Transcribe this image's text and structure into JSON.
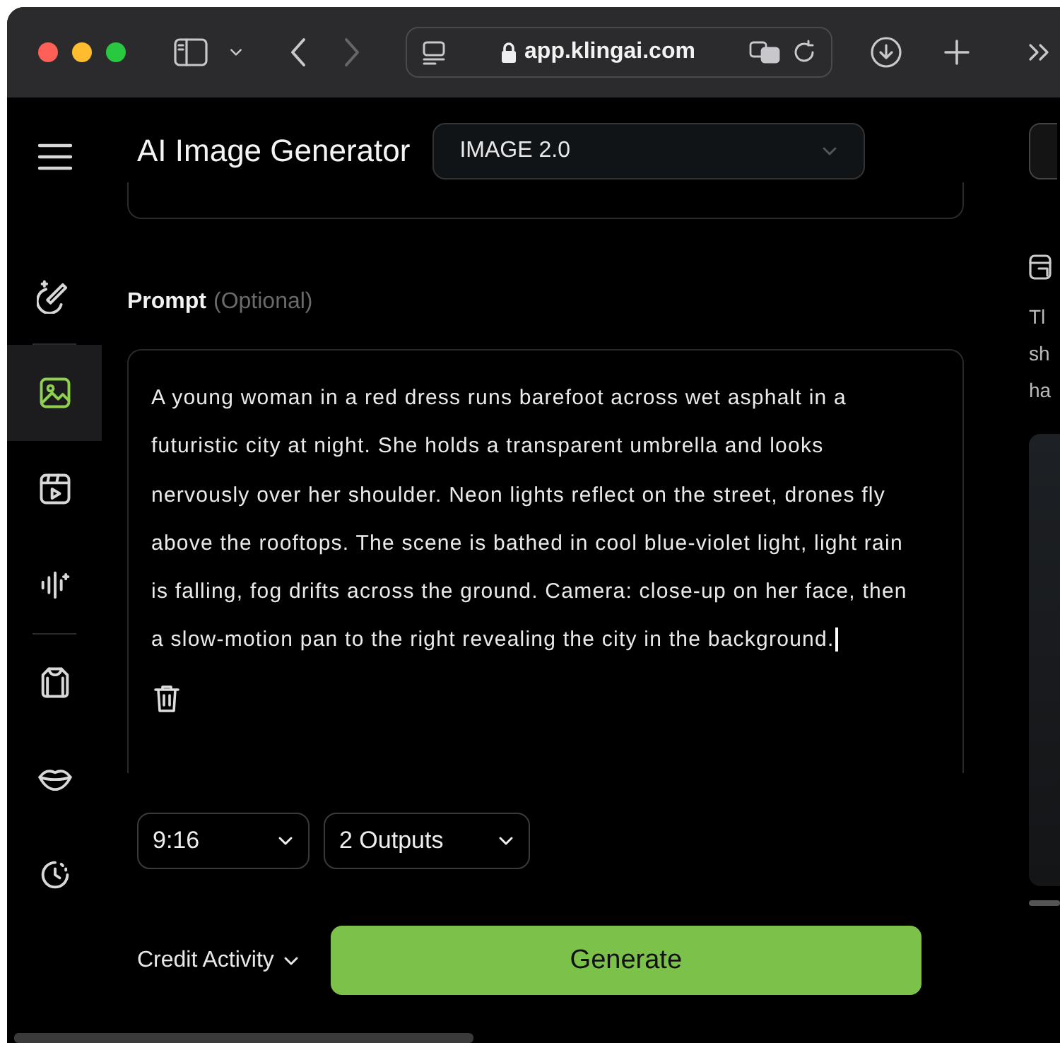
{
  "browser": {
    "url": "app.klingai.com"
  },
  "sidebar": {
    "items": [
      {
        "kind": "wand",
        "selected": false
      },
      {
        "kind": "image",
        "selected": true
      },
      {
        "kind": "film",
        "selected": false
      },
      {
        "kind": "audio",
        "selected": false
      },
      {
        "kind": "shirt",
        "selected": false
      },
      {
        "kind": "lips",
        "selected": false
      },
      {
        "kind": "clock",
        "selected": false
      }
    ]
  },
  "header": {
    "title": "AI Image Generator",
    "model": "IMAGE 2.0"
  },
  "prompt": {
    "label": "Prompt",
    "hint": "(Optional)",
    "value": "A young woman in a red dress runs barefoot across wet asphalt in a futuristic city at night. She holds a transparent umbrella and looks nervously over her shoulder. Neon lights reflect on the street, drones fly above the rooftops. The scene is bathed in cool blue-violet light, light rain is falling, fog drifts across the ground. Camera: close-up on her face, then a slow-motion pan to the right revealing the city in the background."
  },
  "options": [
    {
      "value": "9:16"
    },
    {
      "value": "2 Outputs"
    }
  ],
  "footer": {
    "credit": "Credit Activity",
    "generate": "Generate"
  },
  "right_panel": {
    "lines": [
      "Tl",
      "sh",
      "ha"
    ]
  }
}
